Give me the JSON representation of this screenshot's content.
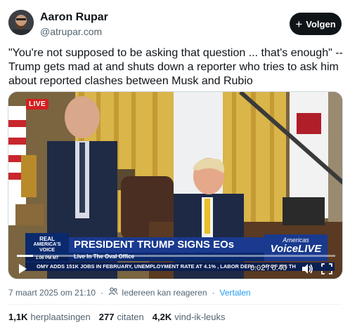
{
  "author": {
    "name": "Aaron Rupar",
    "handle": "@atrupar.com",
    "follow_label": "Volgen"
  },
  "post": {
    "text": "\"You're not supposed to be asking that question ... that's enough\" -- Trump gets mad at and shuts down a reporter who tries to ask him about reported clashes between Musk and Rubio"
  },
  "video": {
    "live_badge": "LIVE",
    "chyron": {
      "logo_line1": "REAL",
      "logo_line2": "AMERICA'S VOICE",
      "time": "1:06 PM MT",
      "headline": "PRESIDENT TRUMP SIGNS EOs",
      "subline": "Live In The Oval Office",
      "brand_top": "Americas",
      "brand_bottom": "VoiceLIVE",
      "ticker": "OMY ADDS 151K JOBS IN FEBRUARY, UNEMPLOYMENT RATE AT 4.1% , LABOR DEPA… OP OF ITS TH"
    },
    "current_time": "0:02",
    "duration": "0:40",
    "progress": 0.05,
    "icons": {
      "play": "play-icon",
      "volume": "volume-icon",
      "fullscreen": "fullscreen-icon"
    }
  },
  "meta": {
    "date": "7 maart 2025 om 21:10",
    "reply_setting": "Iedereen kan reageren",
    "translate_label": "Vertalen"
  },
  "stats": {
    "reposts_count": "1,1K",
    "reposts_label": "herplaatsingen",
    "quotes_count": "277",
    "quotes_label": "citaten",
    "likes_count": "4,2K",
    "likes_label": "vind-ik-leuks"
  },
  "colors": {
    "accent": "#1d9bf0",
    "text": "#0f1419",
    "muted": "#536471",
    "follow_bg": "#0f1419",
    "live_red": "#d32020",
    "chyron_blue": "#1a3a8f"
  }
}
